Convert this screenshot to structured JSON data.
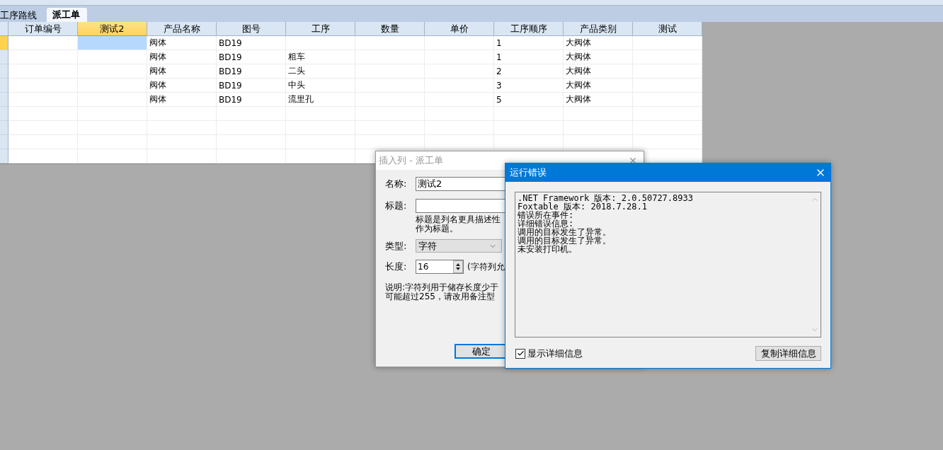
{
  "tabs": [
    {
      "label": "工序路线",
      "selected": false
    },
    {
      "label": "派工单",
      "selected": true
    }
  ],
  "grid": {
    "columns": [
      {
        "label": "订单编号",
        "selected": false
      },
      {
        "label": "测试2",
        "selected": true
      },
      {
        "label": "产品名称",
        "selected": false
      },
      {
        "label": "图号",
        "selected": false
      },
      {
        "label": "工序",
        "selected": false
      },
      {
        "label": "数量",
        "selected": false
      },
      {
        "label": "单价",
        "selected": false
      },
      {
        "label": "工序顺序",
        "selected": false
      },
      {
        "label": "产品类别",
        "selected": false
      },
      {
        "label": "测试",
        "selected": false
      }
    ],
    "rows": [
      {
        "selected": true,
        "cells": [
          "",
          "",
          "阀体",
          "BD19",
          "",
          "",
          "",
          "1",
          "大阀体",
          ""
        ]
      },
      {
        "selected": false,
        "cells": [
          "",
          "",
          "阀体",
          "BD19",
          "粗车",
          "",
          "",
          "1",
          "大阀体",
          ""
        ]
      },
      {
        "selected": false,
        "cells": [
          "",
          "",
          "阀体",
          "BD19",
          "二头",
          "",
          "",
          "2",
          "大阀体",
          ""
        ]
      },
      {
        "selected": false,
        "cells": [
          "",
          "",
          "阀体",
          "BD19",
          "中头",
          "",
          "",
          "3",
          "大阀体",
          ""
        ]
      },
      {
        "selected": false,
        "cells": [
          "",
          "",
          "阀体",
          "BD19",
          "流里孔",
          "",
          "",
          "5",
          "大阀体",
          ""
        ]
      },
      {
        "selected": false,
        "cells": [
          "",
          "",
          "",
          "",
          "",
          "",
          "",
          "",
          "",
          ""
        ]
      },
      {
        "selected": false,
        "cells": [
          "",
          "",
          "",
          "",
          "",
          "",
          "",
          "",
          "",
          ""
        ]
      },
      {
        "selected": false,
        "cells": [
          "",
          "",
          "",
          "",
          "",
          "",
          "",
          "",
          "",
          ""
        ]
      },
      {
        "selected": false,
        "cells": [
          "",
          "",
          "",
          "",
          "",
          "",
          "",
          "",
          "",
          ""
        ]
      }
    ]
  },
  "insert_dialog": {
    "title": "插入列 - 派工单",
    "name_label": "名称:",
    "name_value": "测试2",
    "caption_label": "标题:",
    "caption_hint": [
      "标题是列名更具描述性",
      "作为标题。"
    ],
    "type_label": "类型:",
    "type_value": "字符",
    "length_label": "长度:",
    "length_value": "16",
    "length_note": "(字符列允",
    "description": [
      "说明:字符列用于储存长度少于",
      "可能超过255，请改用备注型"
    ],
    "ok": "确定"
  },
  "error_dialog": {
    "title": "运行错误",
    "lines": [
      ".NET Framework 版本: 2.0.50727.8933",
      "Foxtable 版本: 2018.7.28.1",
      "错误所在事件:",
      "详细错误信息:",
      "调用的目标发生了异常。",
      "调用的目标发生了异常。",
      "未安装打印机。"
    ],
    "show_details": {
      "label": "显示详细信息",
      "checked": true
    },
    "copy_button": "复制详细信息"
  }
}
